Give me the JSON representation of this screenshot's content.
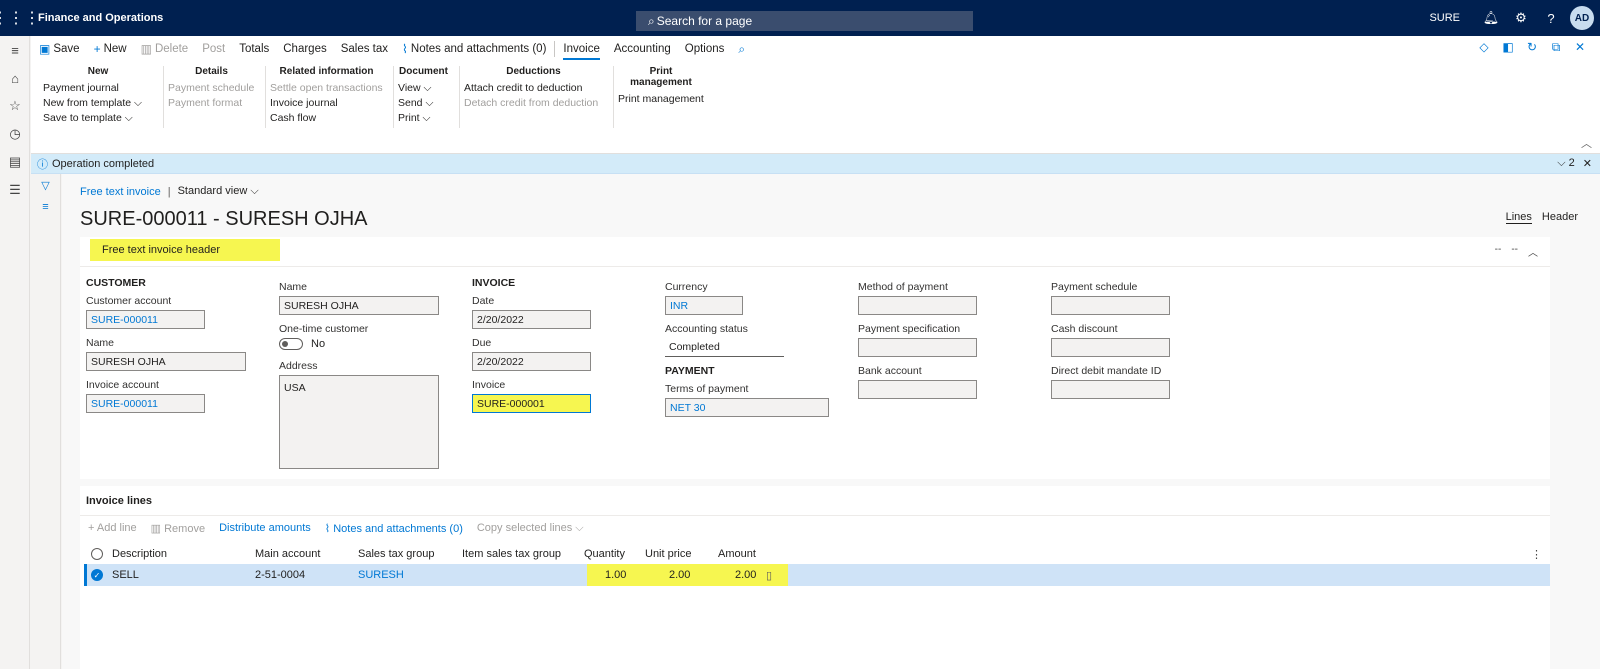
{
  "topbar": {
    "app_title": "Finance and Operations",
    "search_placeholder": "Search for a page",
    "company": "SURE",
    "avatar": "AD"
  },
  "actionpane": {
    "buttons": {
      "save": "Save",
      "new": "New",
      "delete": "Delete",
      "post": "Post",
      "totals": "Totals",
      "charges": "Charges",
      "sales_tax": "Sales tax",
      "notes": "Notes and attachments (0)",
      "invoice": "Invoice",
      "accounting": "Accounting",
      "options": "Options"
    },
    "groups": {
      "new": {
        "header": "New",
        "items": [
          "Payment journal",
          "New from template ⌵",
          "Save to template ⌵"
        ]
      },
      "details": {
        "header": "Details",
        "items": [
          "Payment schedule",
          "Payment format"
        ]
      },
      "related": {
        "header": "Related information",
        "items": [
          "Settle open transactions",
          "Invoice journal",
          "Cash flow"
        ]
      },
      "document": {
        "header": "Document",
        "items": [
          "View ⌵",
          "Send ⌵",
          "Print ⌵"
        ]
      },
      "deductions": {
        "header": "Deductions",
        "items": [
          "Attach credit to deduction",
          "Detach credit from deduction"
        ]
      },
      "print": {
        "header": "Print management",
        "items": [
          "Print management"
        ]
      }
    }
  },
  "message": {
    "text": "Operation completed",
    "count": "2"
  },
  "page": {
    "breadcrumb": "Free text invoice",
    "view": "Standard view",
    "title": "SURE-000011 - SURESH OJHA",
    "view_lines": "Lines",
    "view_header": "Header"
  },
  "header_tab": {
    "title": "Free text invoice header",
    "customer": {
      "section": "CUSTOMER",
      "customer_account_label": "Customer account",
      "customer_account": "SURE-000011",
      "name_label": "Name",
      "name": "SURESH OJHA",
      "invoice_account_label": "Invoice account",
      "invoice_account": "SURE-000011"
    },
    "col2": {
      "name_label": "Name",
      "name": "SURESH OJHA",
      "onetime_label": "One-time customer",
      "onetime_value": "No",
      "address_label": "Address",
      "address": "USA"
    },
    "invoice": {
      "section": "INVOICE",
      "date_label": "Date",
      "date": "2/20/2022",
      "due_label": "Due",
      "due": "2/20/2022",
      "invoice_label": "Invoice",
      "invoice": "SURE-000001"
    },
    "col4": {
      "currency_label": "Currency",
      "currency": "INR",
      "acct_status_label": "Accounting status",
      "acct_status": "Completed",
      "payment_section": "PAYMENT",
      "terms_label": "Terms of payment",
      "terms": "NET 30"
    },
    "col5": {
      "method_label": "Method of payment",
      "spec_label": "Payment specification",
      "bank_label": "Bank account"
    },
    "col6": {
      "schedule_label": "Payment schedule",
      "discount_label": "Cash discount",
      "mandate_label": "Direct debit mandate ID"
    }
  },
  "lines": {
    "title": "Invoice lines",
    "toolbar": {
      "add": "Add line",
      "remove": "Remove",
      "distribute": "Distribute amounts",
      "notes": "Notes and attachments (0)",
      "copy": "Copy selected lines"
    },
    "columns": [
      "Description",
      "Main account",
      "Sales tax group",
      "Item sales tax group",
      "Quantity",
      "Unit price",
      "Amount"
    ],
    "rows": [
      {
        "description": "SELL",
        "main_account": "2-51-0004",
        "sales_tax_group": "SURESH",
        "item_sales_tax_group": "",
        "quantity": "1.00",
        "unit_price": "2.00",
        "amount": "2.00"
      }
    ]
  }
}
